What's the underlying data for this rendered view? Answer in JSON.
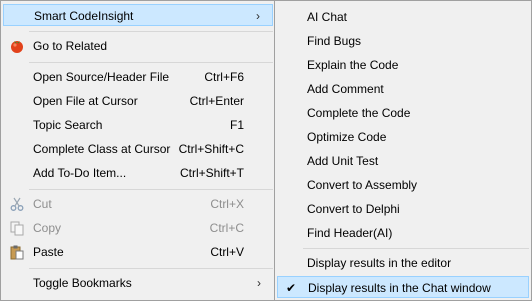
{
  "main_menu": {
    "items": [
      {
        "id": "smart-codeinsight",
        "label": "Smart CodeInsight",
        "shortcut": "",
        "has_submenu": true
      },
      {
        "id": "go-to-related",
        "label": "Go to Related",
        "shortcut": ""
      },
      {
        "id": "open-source-header",
        "label": "Open Source/Header File",
        "shortcut": "Ctrl+F6"
      },
      {
        "id": "open-file-at-cursor",
        "label": "Open File at Cursor",
        "shortcut": "Ctrl+Enter"
      },
      {
        "id": "topic-search",
        "label": "Topic Search",
        "shortcut": "F1"
      },
      {
        "id": "complete-class",
        "label": "Complete Class at Cursor",
        "shortcut": "Ctrl+Shift+C"
      },
      {
        "id": "add-todo",
        "label": "Add To-Do Item...",
        "shortcut": "Ctrl+Shift+T"
      },
      {
        "id": "cut",
        "label": "Cut",
        "shortcut": "Ctrl+X",
        "disabled": true
      },
      {
        "id": "copy",
        "label": "Copy",
        "shortcut": "Ctrl+C",
        "disabled": true
      },
      {
        "id": "paste",
        "label": "Paste",
        "shortcut": "Ctrl+V"
      },
      {
        "id": "toggle-bookmarks",
        "label": "Toggle Bookmarks",
        "shortcut": "",
        "has_submenu": true
      }
    ],
    "arrow_glyph": "›"
  },
  "submenu": {
    "items": [
      {
        "id": "ai-chat",
        "label": "AI Chat"
      },
      {
        "id": "find-bugs",
        "label": "Find Bugs"
      },
      {
        "id": "explain-code",
        "label": "Explain the Code"
      },
      {
        "id": "add-comment",
        "label": "Add Comment"
      },
      {
        "id": "complete-code",
        "label": "Complete the Code"
      },
      {
        "id": "optimize-code",
        "label": "Optimize Code"
      },
      {
        "id": "add-unit-test",
        "label": "Add Unit Test"
      },
      {
        "id": "convert-assembly",
        "label": "Convert to Assembly"
      },
      {
        "id": "convert-delphi",
        "label": "Convert to Delphi"
      },
      {
        "id": "find-header-ai",
        "label": "Find Header(AI)"
      },
      {
        "id": "display-editor",
        "label": "Display results in the editor"
      },
      {
        "id": "display-chat",
        "label": "Display results in the Chat window",
        "checked": true
      }
    ],
    "check_glyph": "✔"
  },
  "colors": {
    "highlight_bg": "#cce8ff",
    "highlight_border": "#99d1ff",
    "disabled_text": "#8e8e8e",
    "menu_bg": "#f0f0f0"
  }
}
